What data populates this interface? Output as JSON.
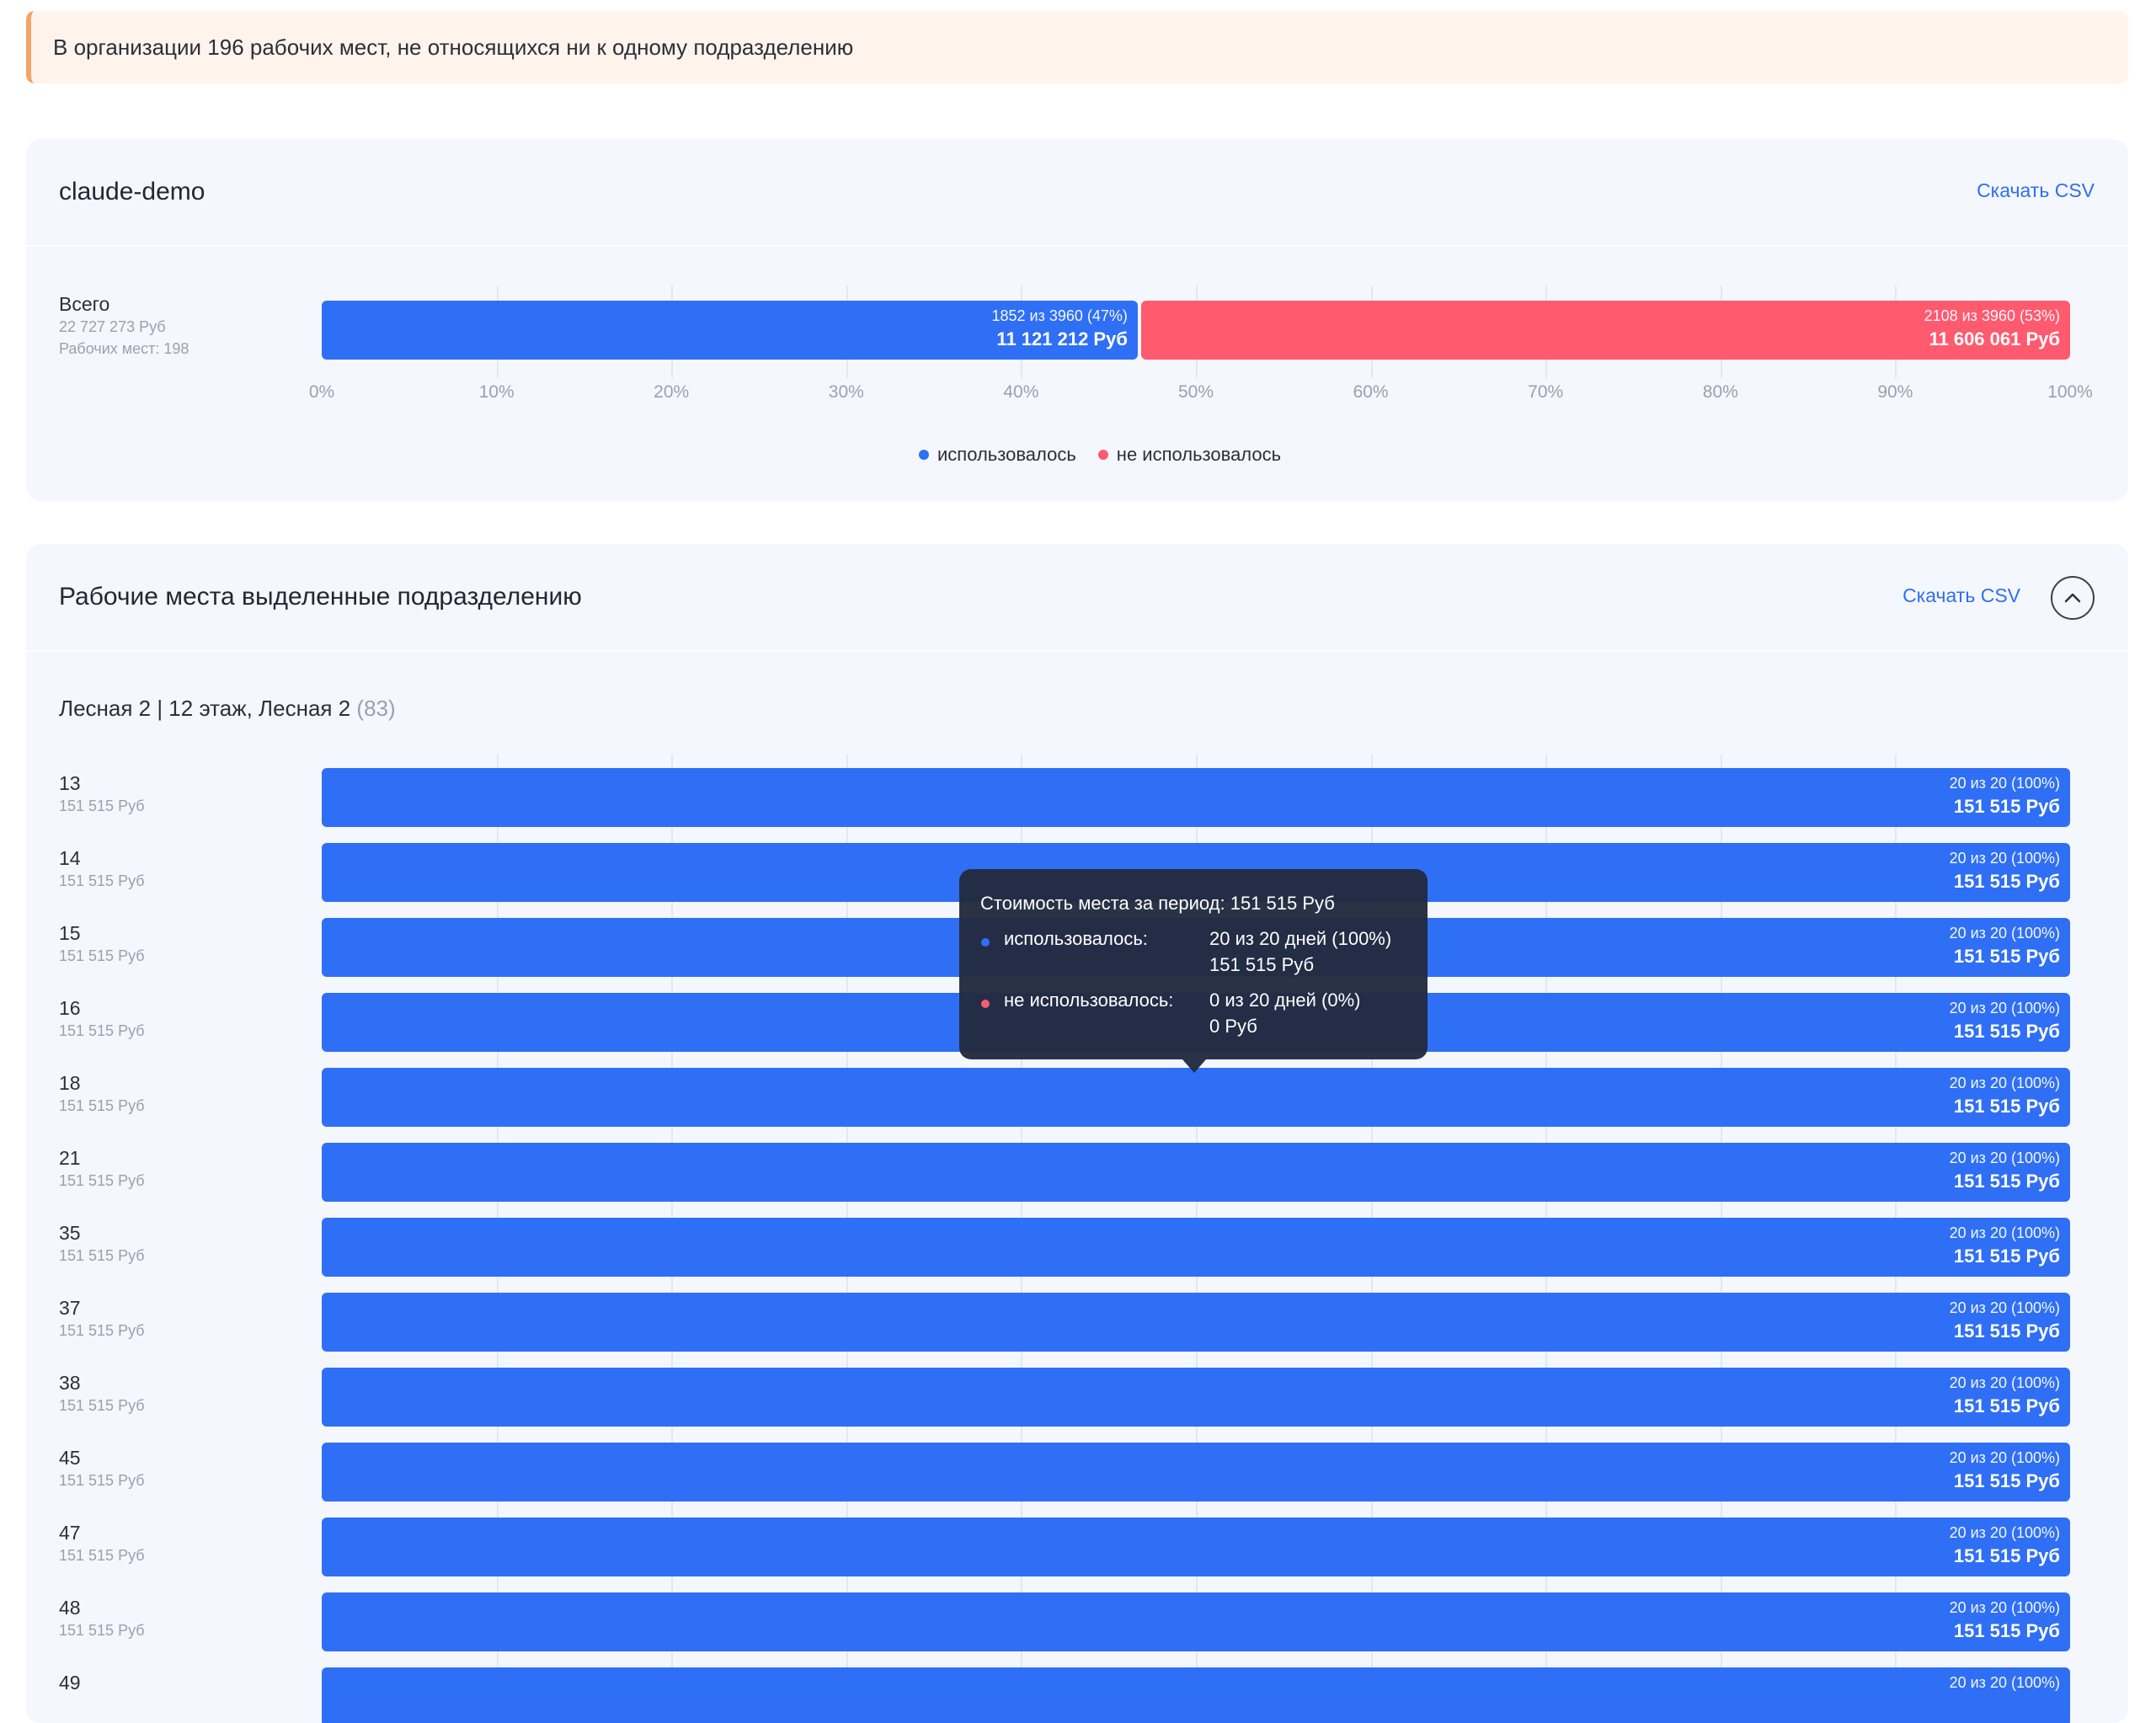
{
  "banner": {
    "text": "В организации 196 рабочих мест, не относящихся ни к одному подразделению"
  },
  "summary_card": {
    "title": "claude-demo",
    "csv_label": "Скачать CSV",
    "total": {
      "name": "Всего",
      "cost": "22 727 273 Руб",
      "seats": "Рабочих мест: 198"
    },
    "used": {
      "label_top": "1852 из 3960 (47%)",
      "label_bottom": "11 121 212 Руб",
      "fraction": 0.4677
    },
    "unused": {
      "label_top": "2108 из 3960 (53%)",
      "label_bottom": "11 606 061 Руб",
      "fraction": 0.5323
    },
    "ticks": [
      "0%",
      "10%",
      "20%",
      "30%",
      "40%",
      "50%",
      "60%",
      "70%",
      "80%",
      "90%",
      "100%"
    ],
    "legend": [
      {
        "label": "использовалось",
        "color": "#2f6ff6"
      },
      {
        "label": "не использовалось",
        "color": "#ff5a6e"
      }
    ]
  },
  "dept_card": {
    "title": "Рабочие места выделенные подразделению",
    "csv_label": "Скачать CSV",
    "group_title": "Лесная 2 | 12 этаж, Лесная 2",
    "group_count": "(83)",
    "rows": [
      {
        "name": "13",
        "cost": "151 515 Руб",
        "top": "20 из 20 (100%)",
        "bottom": "151 515 Руб",
        "fraction": 1
      },
      {
        "name": "14",
        "cost": "151 515 Руб",
        "top": "20 из 20 (100%)",
        "bottom": "151 515 Руб",
        "fraction": 1
      },
      {
        "name": "15",
        "cost": "151 515 Руб",
        "top": "20 из 20 (100%)",
        "bottom": "151 515 Руб",
        "fraction": 1
      },
      {
        "name": "16",
        "cost": "151 515 Руб",
        "top": "20 из 20 (100%)",
        "bottom": "151 515 Руб",
        "fraction": 1
      },
      {
        "name": "18",
        "cost": "151 515 Руб",
        "top": "20 из 20 (100%)",
        "bottom": "151 515 Руб",
        "fraction": 1
      },
      {
        "name": "21",
        "cost": "151 515 Руб",
        "top": "20 из 20 (100%)",
        "bottom": "151 515 Руб",
        "fraction": 1
      },
      {
        "name": "35",
        "cost": "151 515 Руб",
        "top": "20 из 20 (100%)",
        "bottom": "151 515 Руб",
        "fraction": 1
      },
      {
        "name": "37",
        "cost": "151 515 Руб",
        "top": "20 из 20 (100%)",
        "bottom": "151 515 Руб",
        "fraction": 1
      },
      {
        "name": "38",
        "cost": "151 515 Руб",
        "top": "20 из 20 (100%)",
        "bottom": "151 515 Руб",
        "fraction": 1
      },
      {
        "name": "45",
        "cost": "151 515 Руб",
        "top": "20 из 20 (100%)",
        "bottom": "151 515 Руб",
        "fraction": 1
      },
      {
        "name": "47",
        "cost": "151 515 Руб",
        "top": "20 из 20 (100%)",
        "bottom": "151 515 Руб",
        "fraction": 1
      },
      {
        "name": "48",
        "cost": "151 515 Руб",
        "top": "20 из 20 (100%)",
        "bottom": "151 515 Руб",
        "fraction": 1
      },
      {
        "name": "49",
        "cost": "",
        "top": "20 из 20 (100%)",
        "bottom": "",
        "fraction": 1
      }
    ]
  },
  "tooltip": {
    "title": "Стоимость места за период: 151 515 Руб",
    "used_label": "использовалось:",
    "used_days": "20 из 20 дней (100%)",
    "used_cost": "151 515 Руб",
    "unused_label": "не использовалось:",
    "unused_days": "0 из 20 дней (0%)",
    "unused_cost": "0 Руб"
  },
  "colors": {
    "used": "#2f6ff6",
    "unused": "#ff5a6e",
    "link": "#2f6ff0"
  }
}
